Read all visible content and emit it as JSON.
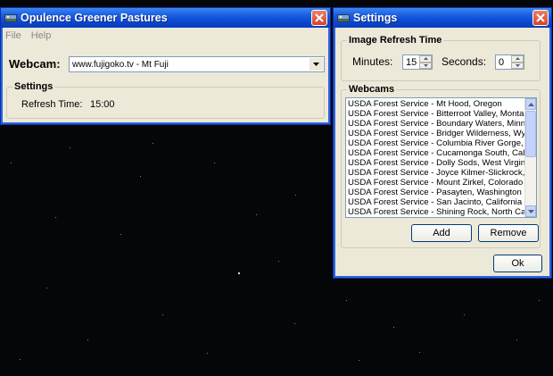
{
  "main_window": {
    "title": "Opulence Greener Pastures",
    "menu": [
      "File",
      "Help"
    ],
    "webcam_label": "Webcam:",
    "webcam_value": "www.fujigoko.tv - Mt Fuji",
    "settings_group": "Settings",
    "refresh_label": "Refresh Time:",
    "refresh_value": "15:00"
  },
  "settings_window": {
    "title": "Settings",
    "refresh_group": "Image Refresh Time",
    "minutes_label": "Minutes:",
    "minutes_value": "15",
    "seconds_label": "Seconds:",
    "seconds_value": "0",
    "webcams_group": "Webcams",
    "webcams": [
      "USDA Forest Service - Mt Hood, Oregon",
      "USDA Forest Service - Bitterroot Valley, Montana",
      "USDA Forest Service - Boundary Waters, Minnesota",
      "USDA Forest Service - Bridger Wilderness, Wyoming",
      "USDA Forest Service - Columbia River Gorge, Oregon",
      "USDA Forest Service - Cucamonga South, California",
      "USDA Forest Service - Dolly Sods, West Virginia",
      "USDA Forest Service - Joyce Kilmer-Slickrock, North Carolina",
      "USDA Forest Service - Mount Zirkel, Colorado",
      "USDA Forest Service - Pasayten, Washington",
      "USDA Forest Service - San Jacinto, California",
      "USDA Forest Service - Shining Rock, North Carolina"
    ],
    "add_label": "Add",
    "remove_label": "Remove",
    "ok_label": "Ok"
  },
  "colors": {
    "desktop": "#050607",
    "titlebar": "#0b47d0",
    "window_face": "#ece9d8",
    "close_button": "#d3452a"
  }
}
